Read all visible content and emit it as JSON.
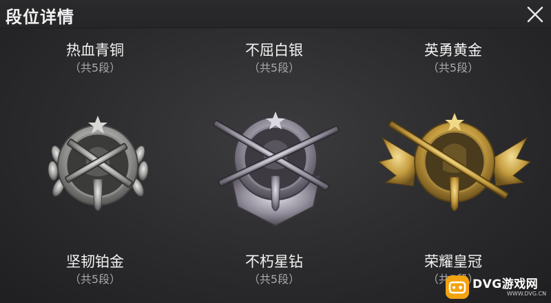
{
  "header": {
    "title": "段位详情"
  },
  "ranks": [
    {
      "name": "热血青铜",
      "sub": "（共5段）",
      "tier": "bronze"
    },
    {
      "name": "不屈白银",
      "sub": "（共5段）",
      "tier": "silver"
    },
    {
      "name": "英勇黄金",
      "sub": "（共5段）",
      "tier": "gold"
    },
    {
      "name": "坚韧铂金",
      "sub": "（共5段）",
      "tier": "platinum"
    },
    {
      "name": "不朽星钻",
      "sub": "（共5段）",
      "tier": "diamond"
    },
    {
      "name": "荣耀皇冠",
      "sub": "（共5段）",
      "tier": "crown"
    }
  ],
  "watermark": {
    "text": "DVG游戏网",
    "small": "WWW.DVG.CN"
  },
  "colors": {
    "background": "#2b2b2d",
    "platinum": "#a9aaa8",
    "diamond": "#9c97a3",
    "gold": "#c9a448"
  },
  "icons": [
    "close-icon",
    "platinum-badge-icon",
    "diamond-badge-icon",
    "gold-badge-icon",
    "dvg-logo-icon"
  ]
}
